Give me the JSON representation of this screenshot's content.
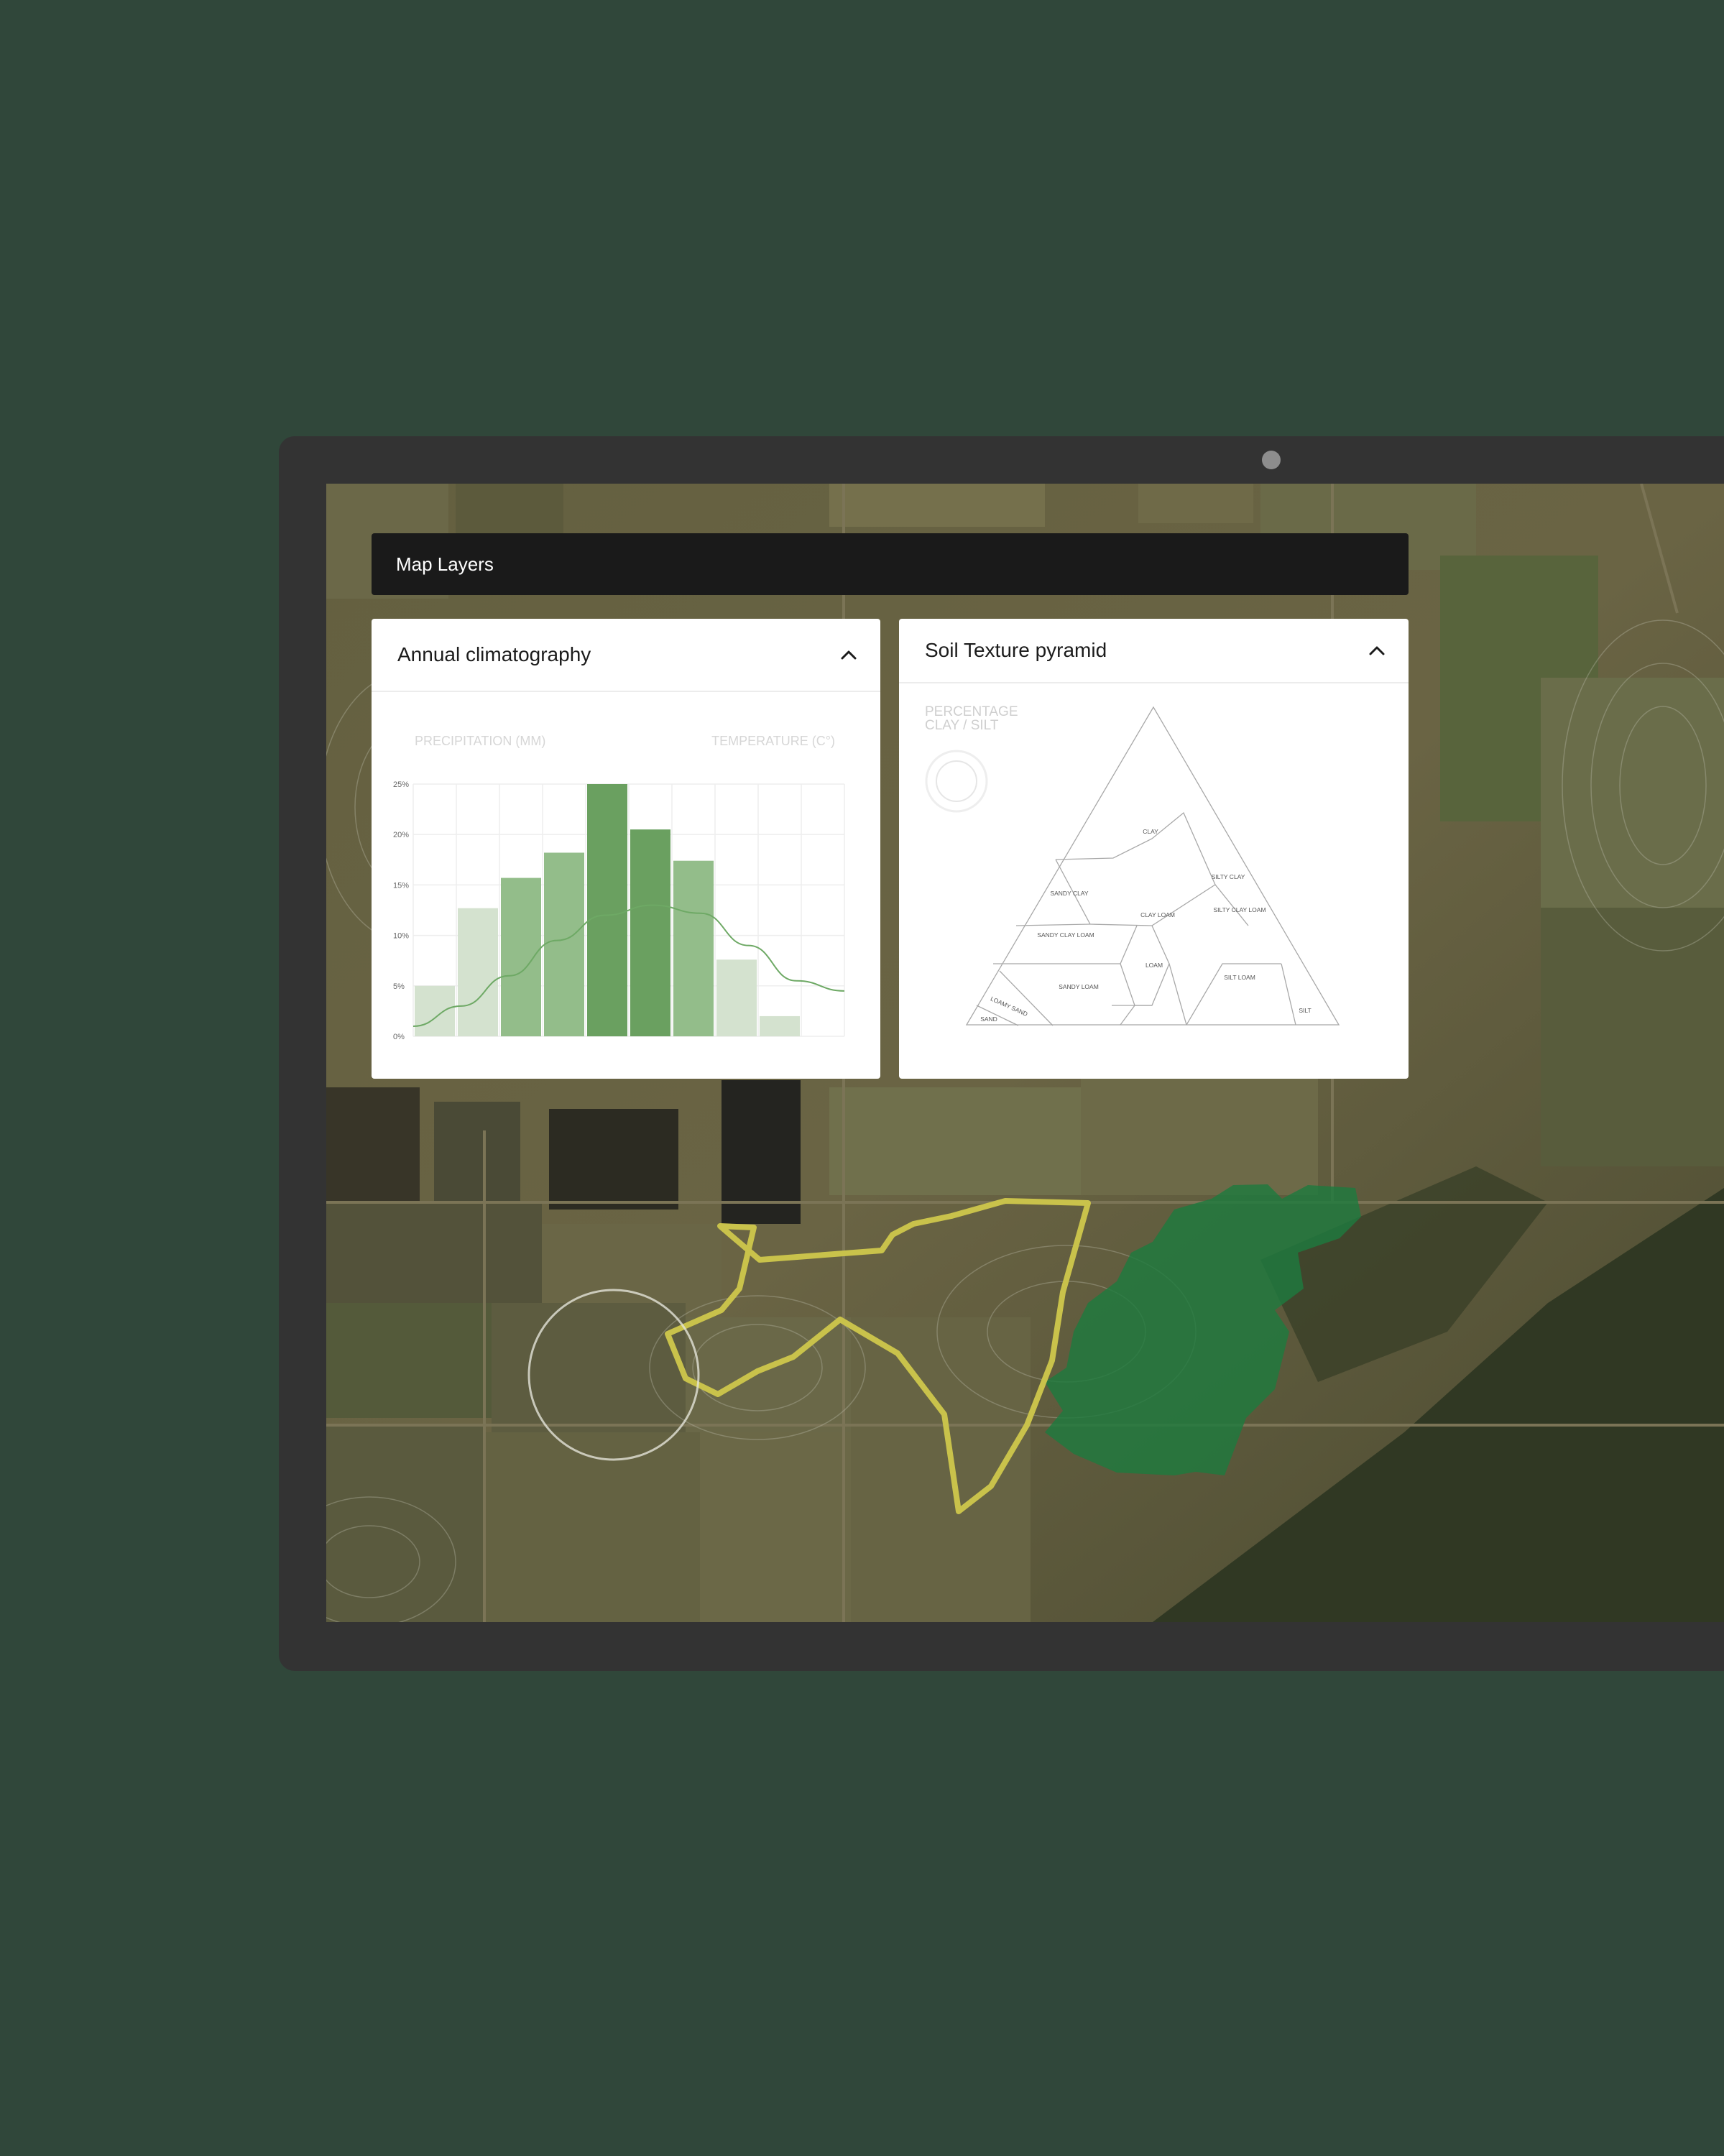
{
  "map_layers": {
    "title": "Map Layers"
  },
  "climate_panel": {
    "title": "Annual climatography",
    "collapse_icon": "chevron-up-icon"
  },
  "soil_panel": {
    "title": "Soil Texture pyramid",
    "collapse_icon": "chevron-up-icon",
    "side_label_line1": "PERCENTAGE",
    "side_label_line2": "CLAY / SILT",
    "regions": {
      "clay": "CLAY",
      "silty_clay": "SILTY CLAY",
      "sandy_clay": "SANDY CLAY",
      "clay_loam": "CLAY LOAM",
      "silty_clay_loam": "SILTY CLAY LOAM",
      "sandy_clay_loam": "SANDY CLAY LOAM",
      "loam": "LOAM",
      "sandy_loam": "SANDY LOAM",
      "silt_loam": "SILT LOAM",
      "loamy_sand": "LOAMY SAND",
      "sand": "SAND",
      "silt": "SILT"
    }
  },
  "colors": {
    "background": "#30473a",
    "bar_light": "#d4e2cf",
    "bar_mid": "#93bd8a",
    "bar_dark": "#6aa060",
    "temperature_line": "#6ea965",
    "boundary_outline": "#c9c24b",
    "vegetation_overlay": "#1e7a3e"
  },
  "chart_data": {
    "type": "bar",
    "left_axis_label": "PRECIPITATION (MM)",
    "right_axis_label": "TEMPERATURE (C°)",
    "ytick_labels": [
      "0%",
      "5%",
      "10%",
      "15%",
      "20%",
      "25%"
    ],
    "ylim": [
      0,
      25
    ],
    "grid": true,
    "values": [
      5,
      12.7,
      15.7,
      18.2,
      25,
      20.5,
      17.4,
      7.6,
      2
    ],
    "intensity": [
      "light",
      "light",
      "mid",
      "mid",
      "dark",
      "dark",
      "mid",
      "light",
      "light"
    ],
    "temperature_curve": [
      1,
      3,
      6,
      9.5,
      12,
      13,
      12.2,
      9,
      5.5,
      4.5
    ]
  }
}
